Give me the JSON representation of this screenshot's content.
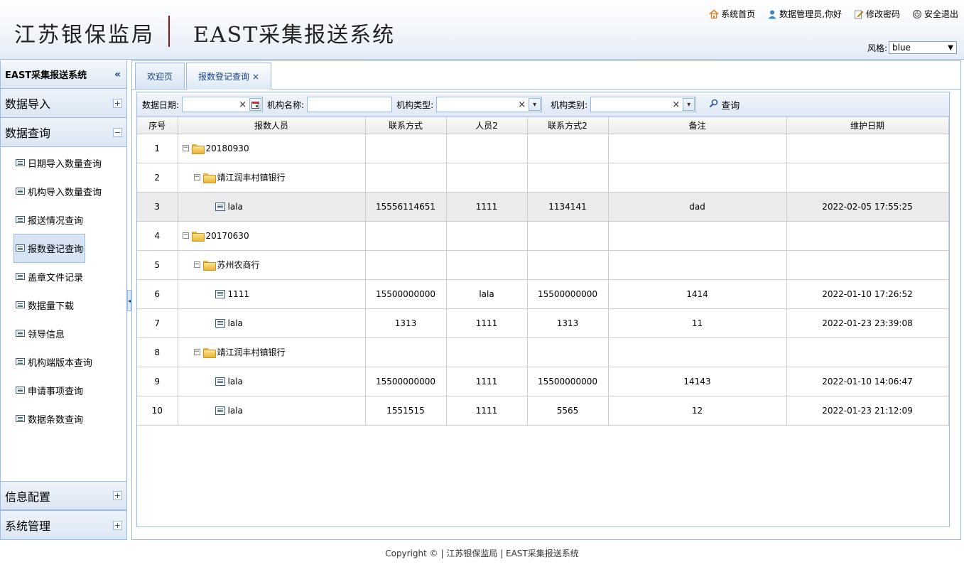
{
  "header": {
    "org_name": "江苏银保监局",
    "system_name": "EAST采集报送系统",
    "links": {
      "home": "系统首页",
      "user": "数据管理员,你好",
      "change_password": "修改密码",
      "logout": "安全退出"
    },
    "style_label": "风格:",
    "style_value": "blue"
  },
  "sidebar": {
    "title": "EAST采集报送系统",
    "collapse_glyph": "«",
    "sections": {
      "import": "数据导入",
      "query": "数据查询",
      "config": "信息配置",
      "system": "系统管理"
    },
    "items": [
      "日期导入数量查询",
      "机构导入数量查询",
      "报送情况查询",
      "报数登记查询",
      "盖章文件记录",
      "数据量下载",
      "领导信息",
      "机构端版本查询",
      "申请事项查询",
      "数据条数查询"
    ],
    "active_index": 3
  },
  "tabs": {
    "welcome": "欢迎页",
    "current": "报数登记查询",
    "close_glyph": "×"
  },
  "toolbar": {
    "date_label": "数据日期:",
    "org_name_label": "机构名称:",
    "org_type_label": "机构类型:",
    "org_category_label": "机构类别:",
    "query_label": "查询",
    "clear_glyph": "×",
    "dropdown_glyph": "▾",
    "date_value": "",
    "org_name_value": "",
    "org_type_value": "",
    "org_category_value": ""
  },
  "grid": {
    "columns": [
      "序号",
      "报数人员",
      "联系方式",
      "人员2",
      "联系方式2",
      "备注",
      "维护日期"
    ],
    "rows": [
      {
        "no": "1",
        "level": 0,
        "type": "folder",
        "name": "20180930",
        "phone": "",
        "person2": "",
        "phone2": "",
        "remark": "",
        "date": ""
      },
      {
        "no": "2",
        "level": 1,
        "type": "folder",
        "name": "靖江润丰村镇银行",
        "phone": "",
        "person2": "",
        "phone2": "",
        "remark": "",
        "date": ""
      },
      {
        "no": "3",
        "level": 2,
        "type": "leaf",
        "name": "lala",
        "phone": "15556114651",
        "person2": "1111",
        "phone2": "1134141",
        "remark": "dad",
        "date": "2022-02-05 17:55:25"
      },
      {
        "no": "4",
        "level": 0,
        "type": "folder",
        "name": "20170630",
        "phone": "",
        "person2": "",
        "phone2": "",
        "remark": "",
        "date": ""
      },
      {
        "no": "5",
        "level": 1,
        "type": "folder",
        "name": "苏州农商行",
        "phone": "",
        "person2": "",
        "phone2": "",
        "remark": "",
        "date": ""
      },
      {
        "no": "6",
        "level": 2,
        "type": "leaf",
        "name": "1111",
        "phone": "15500000000",
        "person2": "lala",
        "phone2": "15500000000",
        "remark": "1414",
        "date": "2022-01-10 17:26:52"
      },
      {
        "no": "7",
        "level": 2,
        "type": "leaf",
        "name": "lala",
        "phone": "1313",
        "person2": "1111",
        "phone2": "1313",
        "remark": "11",
        "date": "2022-01-23 23:39:08"
      },
      {
        "no": "8",
        "level": 1,
        "type": "folder",
        "name": "靖江润丰村镇银行",
        "phone": "",
        "person2": "",
        "phone2": "",
        "remark": "",
        "date": ""
      },
      {
        "no": "9",
        "level": 2,
        "type": "leaf",
        "name": "lala",
        "phone": "15500000000",
        "person2": "1111",
        "phone2": "15500000000",
        "remark": "14143",
        "date": "2022-01-10 14:06:47"
      },
      {
        "no": "10",
        "level": 2,
        "type": "leaf",
        "name": "lala",
        "phone": "1551515",
        "person2": "1111",
        "phone2": "5565",
        "remark": "12",
        "date": "2022-01-23 21:12:09"
      }
    ],
    "highlight_row": 2
  },
  "footer": {
    "text": "Copyright © | 江苏银保监局 | EAST采集报送系统"
  },
  "colors": {
    "border": "#99bbe8",
    "accent": "#15428b",
    "header_bg": "#eef3fa"
  }
}
